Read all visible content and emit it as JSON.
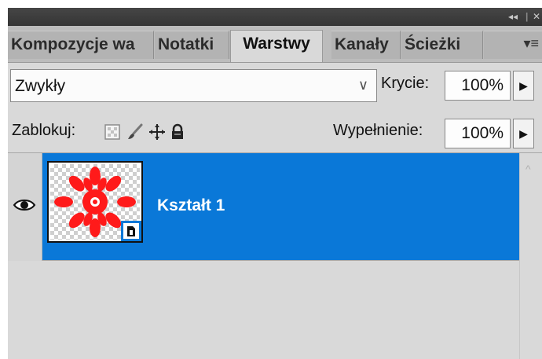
{
  "titlebar": {
    "collapse_icon": "double-chevron-left-icon",
    "collapse_glyph": "◂◂",
    "separator": "|",
    "close_glyph": "✕"
  },
  "tabs": [
    {
      "label": "Kompozycje wa",
      "active": false
    },
    {
      "label": "Notatki",
      "active": false
    },
    {
      "label": "Warstwy",
      "active": true
    },
    {
      "label": "Kanały",
      "active": false
    },
    {
      "label": "Ścieżki",
      "active": false
    }
  ],
  "panel_menu_glyph": "▾≡",
  "blend_mode": {
    "value": "Zwykły",
    "arrow": "∨"
  },
  "opacity": {
    "label": "Krycie:",
    "value": "100%",
    "arrow": "▶"
  },
  "lock": {
    "label": "Zablokuj:",
    "icons": [
      "lock-transparent-icon",
      "lock-brush-icon",
      "lock-move-icon",
      "lock-all-icon"
    ]
  },
  "fill": {
    "label": "Wypełnienie:",
    "value": "100%",
    "arrow": "▶"
  },
  "layers": [
    {
      "name": "Kształt 1",
      "selected": true,
      "visible": true,
      "thumbnail": "red-flower-shape"
    }
  ],
  "scroll_up_glyph": "^",
  "colors": {
    "selection": "#0a78d8",
    "shape_fill": "#ff0000",
    "panel_bg": "#d9d9d9"
  }
}
